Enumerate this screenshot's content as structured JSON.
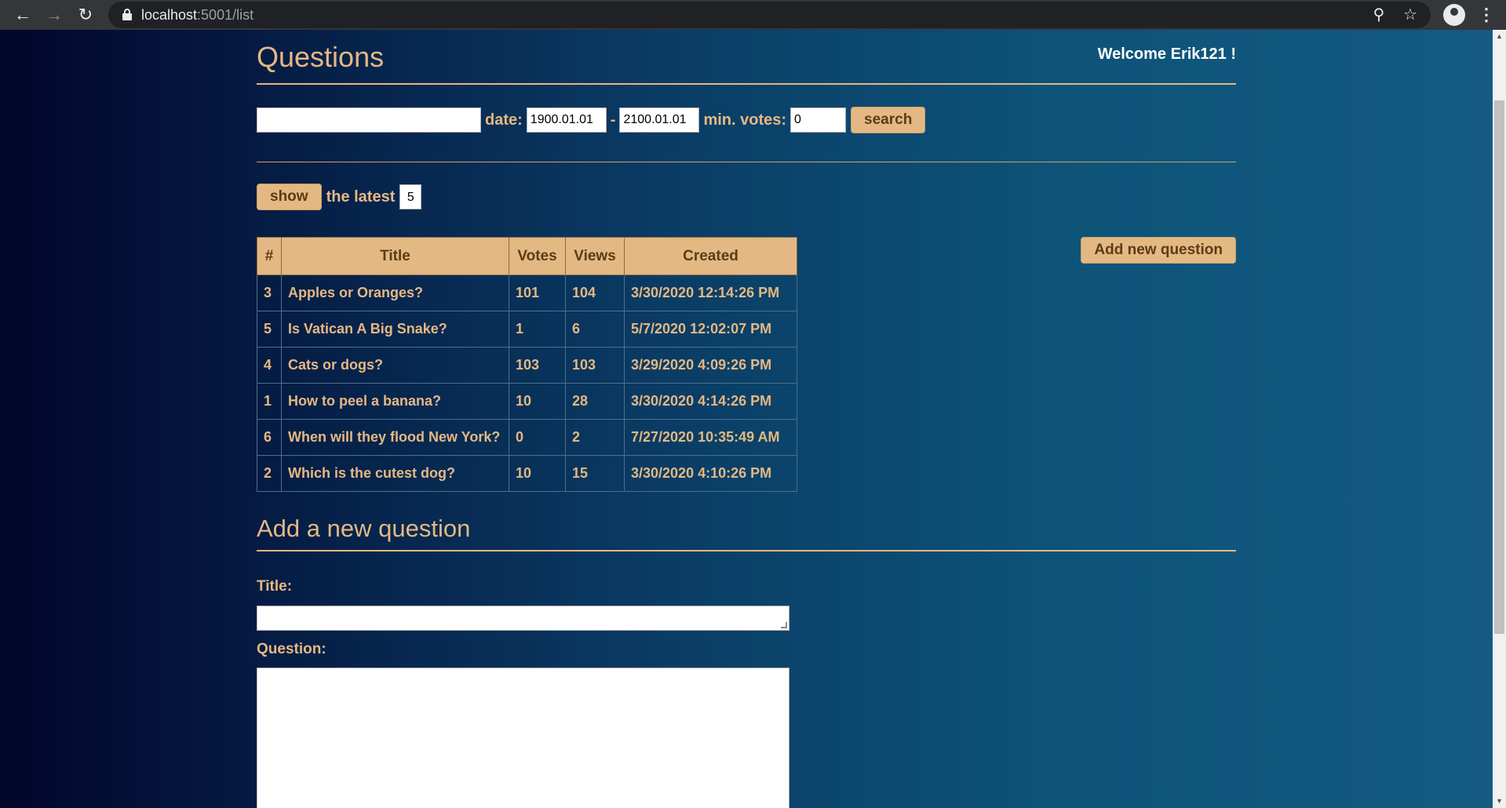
{
  "browser": {
    "url_host": "localhost",
    "url_path": ":5001/list"
  },
  "page": {
    "title": "Questions",
    "welcome": "Welcome Erik121 !"
  },
  "search": {
    "query_value": "",
    "date_label": "date:",
    "date_from": "1900.01.01",
    "date_sep": "-",
    "date_to": "2100.01.01",
    "min_votes_label": "min. votes:",
    "min_votes": "0",
    "button": "search"
  },
  "latest": {
    "button": "show",
    "label": "the latest",
    "count": "5"
  },
  "table": {
    "headers": [
      "#",
      "Title",
      "Votes",
      "Views",
      "Created"
    ],
    "rows": [
      [
        "3",
        "Apples or Oranges?",
        "101",
        "104",
        "3/30/2020 12:14:26 PM"
      ],
      [
        "5",
        "Is Vatican A Big Snake?",
        "1",
        "6",
        "5/7/2020 12:02:07 PM"
      ],
      [
        "4",
        "Cats or dogs?",
        "103",
        "103",
        "3/29/2020 4:09:26 PM"
      ],
      [
        "1",
        "How to peel a banana?",
        "10",
        "28",
        "3/30/2020 4:14:26 PM"
      ],
      [
        "6",
        "When will they flood New York?",
        "0",
        "2",
        "7/27/2020 10:35:49 AM"
      ],
      [
        "2",
        "Which is the cutest dog?",
        "10",
        "15",
        "3/30/2020 4:10:26 PM"
      ]
    ]
  },
  "add_button": "Add new question",
  "form": {
    "heading": "Add a new question",
    "title_label": "Title:",
    "question_label": "Question:"
  },
  "icons": {
    "back": "arrow-left-icon",
    "forward": "arrow-right-icon",
    "reload": "reload-icon",
    "zoom": "zoom-icon",
    "bookmark": "star-icon",
    "profile": "account-icon",
    "menu": "kebab-menu-icon"
  },
  "colors": {
    "accent": "#e4b882",
    "background_dark": "#02052a",
    "background_light": "#145b82"
  }
}
